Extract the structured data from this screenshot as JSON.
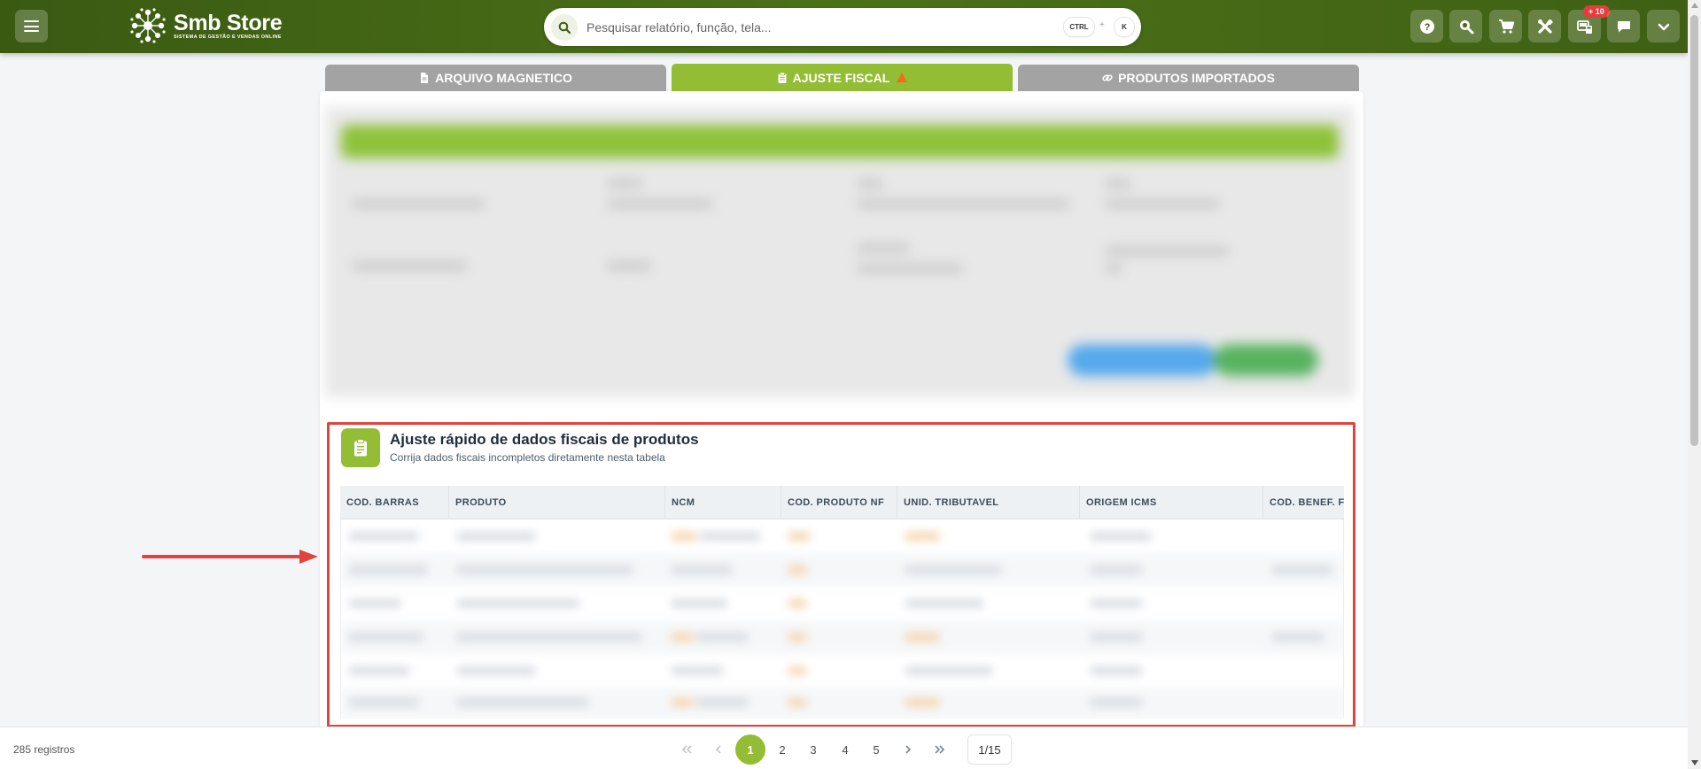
{
  "app": {
    "name": "Smb Store",
    "tagline": "SISTEMA DE GESTÃO E VENDAS ONLINE",
    "accent_color": "#93bd34",
    "header_color": "#466a16"
  },
  "header": {
    "menu_icon": "hamburger-icon",
    "search": {
      "placeholder": "Pesquisar relatório, função, tela...",
      "value": "",
      "shortcut_ctrl": "CTRL",
      "shortcut_plus": "+",
      "shortcut_key": "K"
    },
    "actions": [
      {
        "icon": "help-icon"
      },
      {
        "icon": "zoom-search-icon"
      },
      {
        "icon": "cart-icon"
      },
      {
        "icon": "tools-icon"
      },
      {
        "icon": "pos-terminal-icon",
        "badge": "+ 10"
      },
      {
        "icon": "chat-icon"
      },
      {
        "icon": "chevron-down-icon"
      }
    ]
  },
  "tabs": [
    {
      "label": "ARQUIVO MAGNETICO",
      "icon": "document-icon",
      "active": false
    },
    {
      "label": "AJUSTE FISCAL",
      "icon": "clipboard-icon",
      "active": true,
      "warning": true
    },
    {
      "label": "PRODUTOS IMPORTADOS",
      "icon": "link-icon",
      "active": false
    }
  ],
  "section": {
    "icon": "clipboard-check-icon",
    "title": "Ajuste rápido de dados fiscais de produtos",
    "subtitle": "Corrija dados fiscais incompletos diretamente nesta tabela",
    "highlight_color": "#e0443d"
  },
  "table": {
    "columns": [
      "COD. BARRAS",
      "PRODUTO",
      "NCM",
      "COD. PRODUTO NF",
      "UNID. TRIBUTAVEL",
      "ORIGEM ICMS",
      "COD. BENEF. F"
    ]
  },
  "footer": {
    "records": "285 registros",
    "pages": [
      "1",
      "2",
      "3",
      "4",
      "5"
    ],
    "current_page": "1",
    "page_indicator": "1/15"
  }
}
